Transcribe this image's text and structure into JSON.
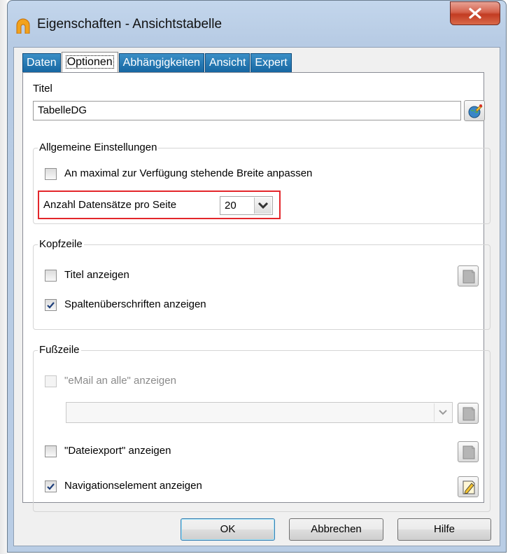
{
  "window": {
    "title": "Eigenschaften - Ansichtstabelle"
  },
  "tabs": [
    {
      "label": "Daten"
    },
    {
      "label": "Optionen",
      "active": true
    },
    {
      "label": "Abhängigkeiten"
    },
    {
      "label": "Ansicht"
    },
    {
      "label": "Expert"
    }
  ],
  "titel": {
    "label": "Titel",
    "value": "TabelleDG"
  },
  "allgemein": {
    "legend": "Allgemeine Einstellungen",
    "fit_width_label": "An maximal zur Verfügung stehende Breite anpassen",
    "fit_width_checked": false,
    "records_label": "Anzahl Datensätze pro Seite",
    "records_value": "20"
  },
  "kopfzeile": {
    "legend": "Kopfzeile",
    "show_title_label": "Titel anzeigen",
    "show_title_checked": false,
    "show_headers_label": "Spaltenüberschriften anzeigen",
    "show_headers_checked": true
  },
  "fusszeile": {
    "legend": "Fußzeile",
    "email_label": "\"eMail an alle\" anzeigen",
    "email_checked": false,
    "email_enabled": false,
    "email_select_value": "",
    "export_label": "\"Dateiexport\" anzeigen",
    "export_checked": false,
    "nav_label": "Navigationselement anzeigen",
    "nav_checked": true
  },
  "buttons": {
    "ok": "OK",
    "cancel": "Abbrechen",
    "help": "Hilfe"
  },
  "colors": {
    "tab_blue": "#1f74b0",
    "highlight_red": "#e3262b",
    "window_frame": "#b9cde5"
  }
}
